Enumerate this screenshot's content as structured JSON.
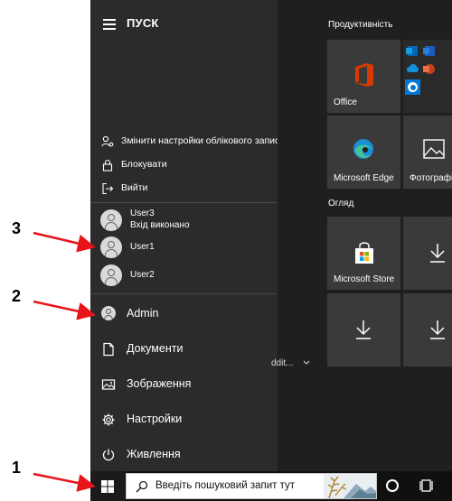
{
  "start_menu": {
    "title": "ПУСК",
    "account_menu": {
      "change_settings": "Змінити настройки облікового запис",
      "lock": "Блокувати",
      "sign_out": "Вийти"
    },
    "users": [
      {
        "name": "User3",
        "status": "Вхід виконано"
      },
      {
        "name": "User1"
      },
      {
        "name": "User2"
      }
    ],
    "current_user": "Admin",
    "nav": {
      "documents": "Документи",
      "pictures": "Зображення",
      "settings": "Настройки",
      "power": "Живлення"
    },
    "partial_app_text": "ddit...",
    "tiles": {
      "group1_label": "Продуктивність",
      "group2_label": "Огляд",
      "office_label": "Office",
      "edge_label": "Microsoft Edge",
      "photos_label": "Фотографі",
      "store_label": "Microsoft Store"
    },
    "icons": {
      "user_settings": "user-settings-icon",
      "lock": "lock-icon",
      "sign_out": "sign-out-icon",
      "document": "document-icon",
      "pictures": "picture-icon",
      "settings": "gear-icon",
      "power": "power-icon",
      "download": "download-icon"
    }
  },
  "taskbar": {
    "search_placeholder": "Введіть пошуковий запит тут"
  },
  "annotations": [
    "1",
    "2",
    "3"
  ],
  "colors": {
    "start_menu_bg": "#2b2b2b",
    "tile_bg": "#3a3a3a",
    "taskbar_bg": "#101010",
    "annotation_arrow": "#e8141c",
    "office_red": "#d83b01",
    "skype_blue": "#0078d4"
  }
}
